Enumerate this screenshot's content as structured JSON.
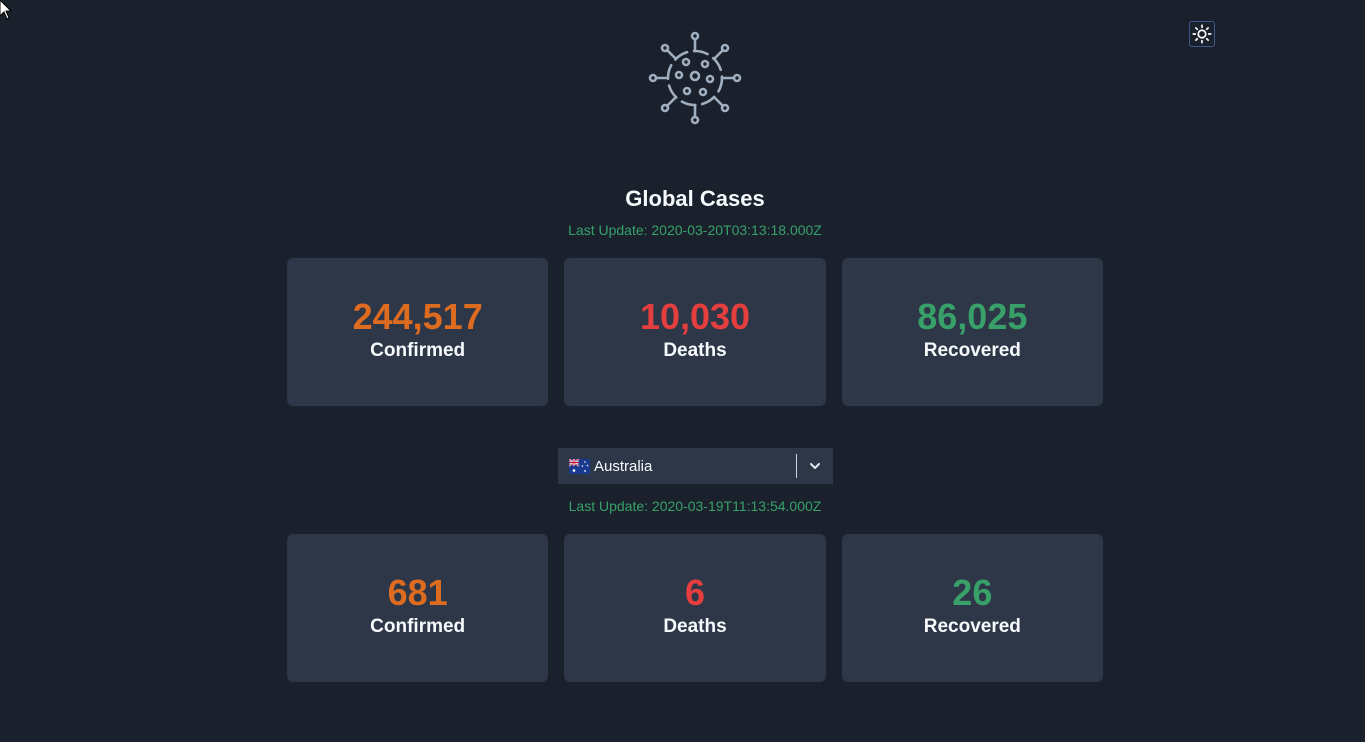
{
  "global": {
    "title": "Global Cases",
    "last_update": "Last Update: 2020-03-20T03:13:18.000Z",
    "confirmed": {
      "value": "244,517",
      "label": "Confirmed"
    },
    "deaths": {
      "value": "10,030",
      "label": "Deaths"
    },
    "recovered": {
      "value": "86,025",
      "label": "Recovered"
    }
  },
  "country": {
    "selected": "Australia",
    "last_update": "Last Update: 2020-03-19T11:13:54.000Z",
    "confirmed": {
      "value": "681",
      "label": "Confirmed"
    },
    "deaths": {
      "value": "6",
      "label": "Deaths"
    },
    "recovered": {
      "value": "26",
      "label": "Recovered"
    }
  },
  "icons": {
    "logo": "virus-icon",
    "theme_toggle": "sun-icon",
    "dropdown": "chevron-down-icon",
    "flag": "australia-flag-icon"
  },
  "colors": {
    "background": "#1a202c",
    "card": "#2d3748",
    "confirmed": "#dd6b20",
    "deaths": "#e53e3e",
    "recovered": "#38a169"
  }
}
